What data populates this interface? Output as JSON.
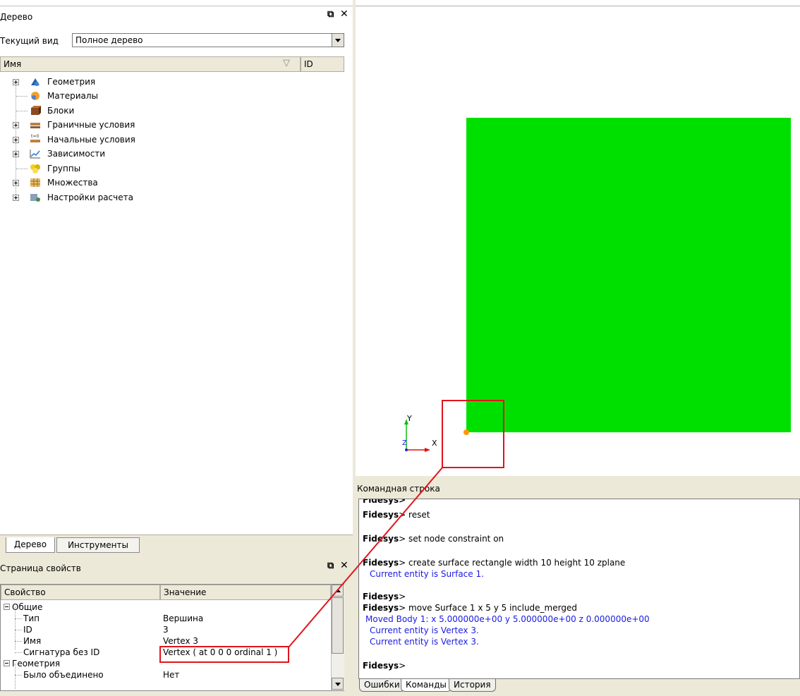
{
  "tree_panel": {
    "title": "Дерево",
    "view_label": "Текущий вид",
    "view_value": "Полное дерево",
    "col_name": "Имя",
    "col_id": "ID",
    "items": [
      {
        "label": "Геометрия",
        "icon": "geometry-icon"
      },
      {
        "label": "Материалы",
        "icon": "materials-icon"
      },
      {
        "label": "Блоки",
        "icon": "blocks-icon"
      },
      {
        "label": "Граничные условия",
        "icon": "boundary-conditions-icon"
      },
      {
        "label": "Начальные условия",
        "icon": "initial-conditions-icon"
      },
      {
        "label": "Зависимости",
        "icon": "dependencies-icon"
      },
      {
        "label": "Группы",
        "icon": "groups-icon"
      },
      {
        "label": "Множества",
        "icon": "sets-icon"
      },
      {
        "label": "Настройки расчета",
        "icon": "calc-settings-icon"
      }
    ],
    "tabs": [
      "Дерево",
      "Инструменты"
    ]
  },
  "properties_panel": {
    "title": "Страница свойств",
    "col_property": "Свойство",
    "col_value": "Значение",
    "rows": [
      {
        "name": "Общие",
        "value": ""
      },
      {
        "name": "Тип",
        "value": "Вершина"
      },
      {
        "name": "ID",
        "value": "3"
      },
      {
        "name": "Имя",
        "value": "Vertex 3"
      },
      {
        "name": "Сигнатура без ID",
        "value": "Vertex ( at 0 0 0 ordinal 1 )"
      },
      {
        "name": "Геометрия",
        "value": ""
      },
      {
        "name": "Было объединено",
        "value": "Нет"
      }
    ]
  },
  "viewport": {
    "surface_color": "#00e000",
    "vertex_color": "#ff9900",
    "axis_x": "X",
    "axis_y": "Y",
    "axis_z": "Z"
  },
  "command_panel": {
    "title": "Командная строка",
    "prompt": "Fidesys",
    "lines": [
      {
        "prompt": "Fidesys",
        "cmd": "reset"
      },
      {
        "prompt": "Fidesys",
        "cmd": "set node constraint on"
      },
      {
        "prompt": "Fidesys",
        "cmd": "create surface rectangle width 10 height 10 zplane"
      },
      {
        "output": "Current entity is Surface 1."
      },
      {
        "prompt": "Fidesys",
        "cmd": ""
      },
      {
        "prompt": "Fidesys",
        "cmd": "move Surface 1  x 5 y 5 include_merged"
      },
      {
        "output": "Moved Body 1:  x 5.000000e+00  y 5.000000e+00  z 0.000000e+00"
      },
      {
        "output": "Current entity is Vertex 3."
      },
      {
        "output": "Current entity is Vertex 3."
      },
      {
        "prompt": "Fidesys",
        "cmd": ""
      }
    ],
    "tabs": [
      "Ошибки",
      "Команды",
      "История"
    ]
  },
  "colors": {
    "highlight_red": "#e0141c",
    "panel_bg": "#ece9d8"
  }
}
